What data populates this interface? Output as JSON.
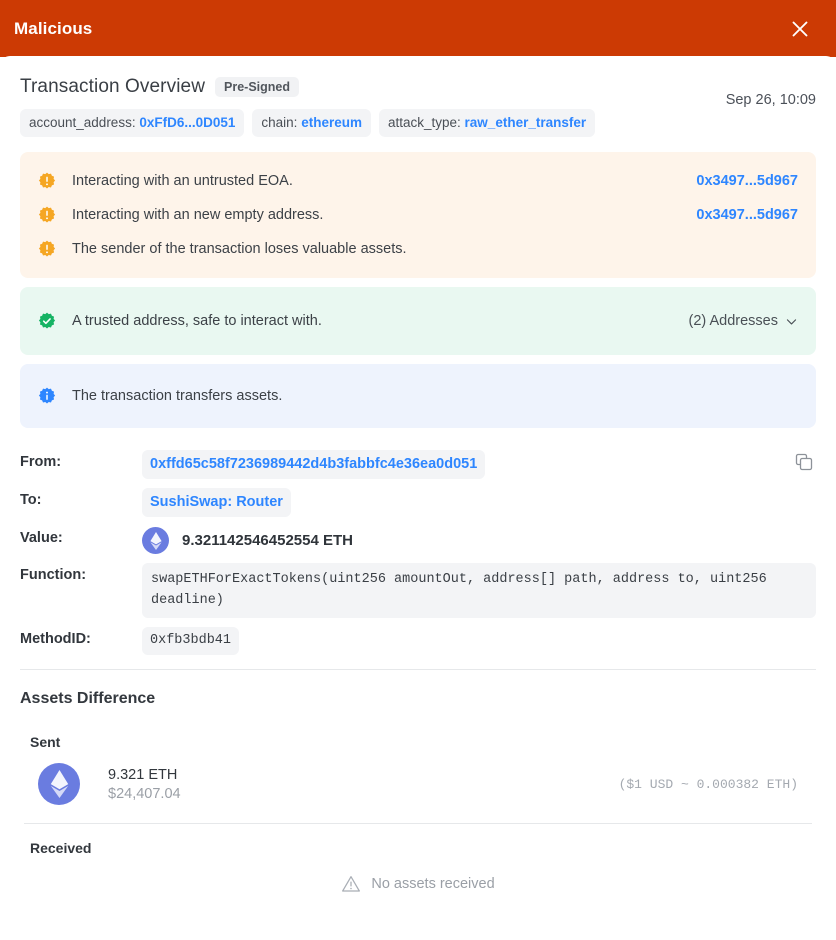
{
  "window": {
    "title": "Malicious",
    "close_icon": "close-icon",
    "accent_color": "#cc3a04"
  },
  "overview": {
    "title": "Transaction Overview",
    "badge": "Pre-Signed",
    "timestamp": "Sep 26, 10:09",
    "tags": [
      {
        "key": "account_address:",
        "value": "0xFfD6...0D051"
      },
      {
        "key": "chain:",
        "value": "ethereum"
      },
      {
        "key": "attack_type:",
        "value": "raw_ether_transfer"
      }
    ]
  },
  "banners": {
    "warning": {
      "background": "#fef4ea",
      "icon": "warning-seal-icon",
      "icon_color": "#f5a623",
      "rows": [
        {
          "text": "Interacting with an untrusted EOA.",
          "right": "0x3497...5d967"
        },
        {
          "text": "Interacting with an new empty address.",
          "right": "0x3497...5d967"
        },
        {
          "text": "The sender of the transaction loses valuable assets.",
          "right": ""
        }
      ]
    },
    "success": {
      "background": "#e9f8f1",
      "icon": "check-seal-icon",
      "icon_color": "#16b364",
      "text": "A trusted address, safe to interact with.",
      "toggle_label": "(2) Addresses",
      "toggle_icon": "chevron-down-icon"
    },
    "info": {
      "background": "#eef3fd",
      "icon": "info-seal-icon",
      "icon_color": "#2e86ff",
      "text": "The transaction transfers assets."
    }
  },
  "details": {
    "copy_icon": "copy-icon",
    "rows": [
      {
        "label": "From:",
        "value": "0xffd65c58f7236989442d4b3fabbfc4e36ea0d051"
      },
      {
        "label": "To:",
        "value": "SushiSwap: Router"
      },
      {
        "label": "Value:",
        "value": "9.321142546452554 ETH",
        "icon": "ethereum-icon"
      },
      {
        "label": "Function:",
        "value": "swapETHForExactTokens(uint256 amountOut, address[] path, address to, uint256 deadline)"
      },
      {
        "label": "MethodID:",
        "value": "0xfb3bdb41"
      }
    ]
  },
  "assets": {
    "title": "Assets Difference",
    "sent": {
      "label": "Sent",
      "icon": "ethereum-icon",
      "amount": "9.321 ETH",
      "usd": "$24,407.04",
      "rate": "($1 USD ~ 0.000382 ETH)"
    },
    "received": {
      "label": "Received",
      "empty_icon": "warning-triangle-icon",
      "empty_text": "No assets received"
    }
  }
}
